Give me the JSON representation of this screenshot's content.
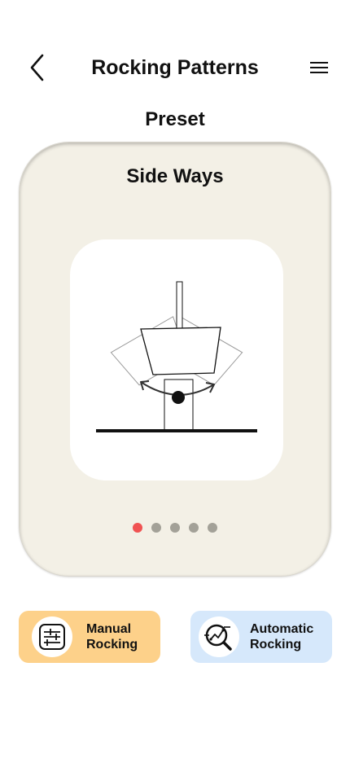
{
  "header": {
    "title": "Rocking Patterns",
    "back_icon": "chevron-left-icon",
    "menu_icon": "hamburger-menu-icon"
  },
  "section": {
    "title": "Preset"
  },
  "preset_card": {
    "title": "Side Ways",
    "illustration": "side-ways-rocking-illustration-icon",
    "pagination": {
      "total": 5,
      "active_index": 0,
      "active_color": "#f05252",
      "inactive_color": "#a3a198"
    }
  },
  "modes": [
    {
      "label": "Manual\nRocking",
      "icon": "sliders-icon",
      "background": "#fdd18a"
    },
    {
      "label": "Automatic\nRocking",
      "icon": "auto-search-icon",
      "background": "#d6e8fb"
    }
  ]
}
